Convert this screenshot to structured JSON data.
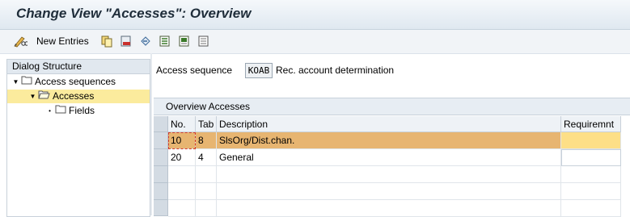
{
  "title": "Change View \"Accesses\": Overview",
  "toolbar": {
    "new_entries": "New Entries",
    "icons": [
      "pencil-glasses-icon",
      "copy-icon",
      "delete-icon",
      "undo-icon",
      "select-all-icon",
      "select-block-icon",
      "deselect-all-icon"
    ]
  },
  "dialog": {
    "header": "Dialog Structure",
    "items": [
      {
        "label": "Access sequences"
      },
      {
        "label": "Accesses"
      },
      {
        "label": "Fields"
      }
    ]
  },
  "access_sequence": {
    "label": "Access sequence",
    "value": "KOAB",
    "description": "Rec. account determination"
  },
  "overview": {
    "caption": "Overview Accesses",
    "columns": [
      "No.",
      "Tab",
      "Description",
      "Requiremnt"
    ],
    "rows": [
      {
        "no": "10",
        "tab": "8",
        "description": "SlsOrg/Dist.chan.",
        "requirement": ""
      },
      {
        "no": "20",
        "tab": "4",
        "description": "General",
        "requirement": ""
      }
    ]
  },
  "colors": {
    "selected_row": "#e7b571",
    "tree_selected": "#fbeb9d",
    "title_text": "#1f2d3a"
  }
}
